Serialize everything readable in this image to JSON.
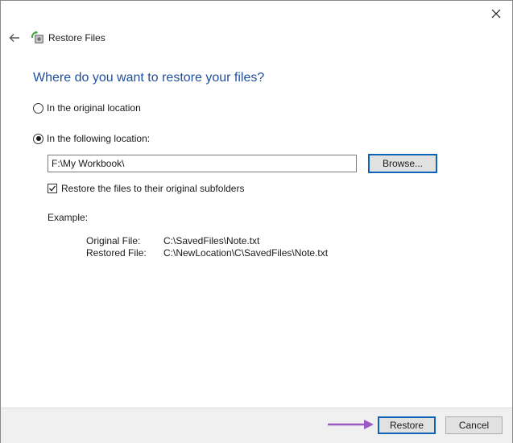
{
  "window": {
    "title": "Restore Files",
    "icons": {
      "close": "close-icon",
      "back": "back-arrow-icon",
      "app": "restore-files-icon"
    }
  },
  "main": {
    "heading": "Where do you want to restore your files?",
    "option_original": "In the original location",
    "option_following": "In the following location:",
    "selected_option": "following",
    "path_value": "F:\\My Workbook\\",
    "browse_label": "Browse...",
    "subfolders_label": "Restore the files to their original subfolders",
    "subfolders_checked": true,
    "example": {
      "label": "Example:",
      "original_key": "Original File:",
      "original_value": "C:\\SavedFiles\\Note.txt",
      "restored_key": "Restored File:",
      "restored_value": "C:\\NewLocation\\C\\SavedFiles\\Note.txt"
    }
  },
  "footer": {
    "restore_label": "Restore",
    "cancel_label": "Cancel"
  },
  "colors": {
    "heading": "#1f4e9c",
    "focus_border": "#0f64b8",
    "annotation_arrow": "#9b59c6",
    "footer_bg": "#f0f0f0"
  }
}
